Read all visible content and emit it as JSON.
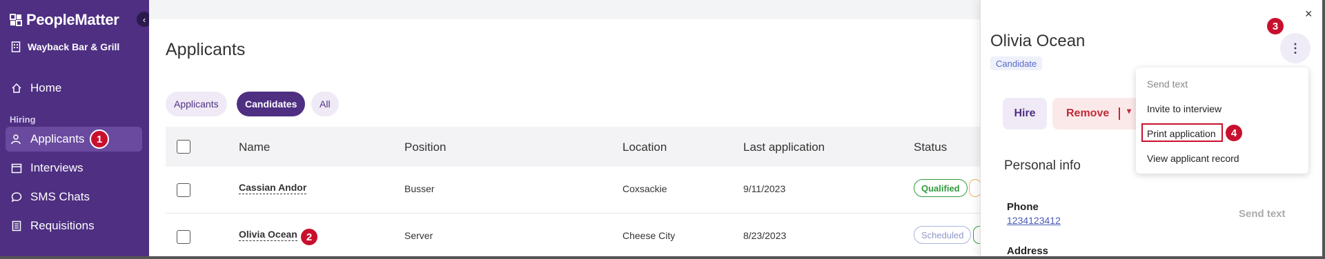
{
  "sidebar": {
    "logo": "PeopleMatter",
    "org": "Wayback Bar & Grill",
    "collapse_icon": "‹",
    "section_label": "Hiring",
    "items": [
      {
        "label": "Home",
        "icon": "home-icon"
      },
      {
        "label": "Applicants",
        "icon": "applicants-icon",
        "active": true
      },
      {
        "label": "Interviews",
        "icon": "calendar-icon"
      },
      {
        "label": "SMS Chats",
        "icon": "chat-icon"
      },
      {
        "label": "Requisitions",
        "icon": "document-icon"
      }
    ]
  },
  "callouts": [
    "1",
    "2",
    "3",
    "4"
  ],
  "main": {
    "title": "Applicants",
    "filters": [
      "Applicants",
      "Candidates",
      "All"
    ],
    "selected_filter": "Candidates",
    "columns": [
      "Name",
      "Position",
      "Location",
      "Last application",
      "Status"
    ],
    "rows": [
      {
        "name": "Cassian Andor",
        "position": "Busser",
        "location": "Coxsackie",
        "last_application": "9/11/2023",
        "status": "Qualified"
      },
      {
        "name": "Olivia Ocean",
        "position": "Server",
        "location": "Cheese City",
        "last_application": "8/23/2023",
        "status": "Scheduled"
      }
    ]
  },
  "panel": {
    "name": "Olivia Ocean",
    "badge": "Candidate",
    "close_icon": "×",
    "more_icon": "⋮",
    "hire_label": "Hire",
    "remove_label": "Remove",
    "remove_caret": "▾",
    "section_title": "Personal info",
    "phone_label": "Phone",
    "phone_value": "1234123412",
    "send_text_label": "Send text",
    "address_label": "Address"
  },
  "menu": {
    "items": [
      "Send text",
      "Invite to interview",
      "Print application",
      "View applicant record"
    ]
  },
  "colors": {
    "sidebar": "#4e2f82",
    "accent": "#4e2f82",
    "callout": "#c8102e",
    "qualified": "#2f9a3b",
    "remove": "#c02a36"
  }
}
